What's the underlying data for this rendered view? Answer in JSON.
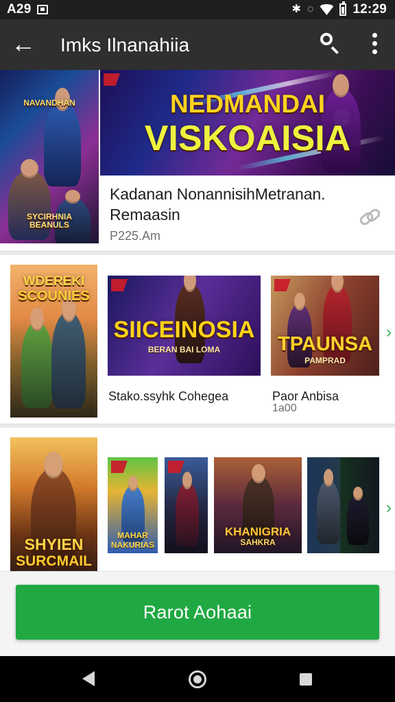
{
  "status_bar": {
    "time_left": "A29",
    "time_right": "12:29",
    "bluetooth_icon": "bluetooth-icon",
    "vibrate_icon": "vibrate-icon",
    "wifi_icon": "wifi-icon",
    "battery_icon": "battery-icon",
    "notification_icon": "notification-icon"
  },
  "app_bar": {
    "title": "Imks Ilnanahiia",
    "back_icon": "back-arrow-icon",
    "search_icon": "search-icon",
    "menu_icon": "more-vert-icon"
  },
  "featured": {
    "banner_title_top": "NEDMANDAI",
    "banner_title_bottom": "VISKOAISIA",
    "left_badge_top": "NAVANDHAN",
    "left_badge_bottom": "SYCIRHNIA\nBEANULS",
    "title_line_1": "Kadanan NonannisihMetranan.",
    "title_line_2": "Remaasin",
    "meta": "P225.Am",
    "link_icon": "link-icon"
  },
  "rows": [
    {
      "poster_title_top": "WDEREKI",
      "poster_title_bottom": "SCOUNIES",
      "items": [
        {
          "title_top": "SIICEINOSIA",
          "title_bottom": "BERAN BAI LOMA",
          "label": "Stako.ssyhk Cohegea"
        },
        {
          "title_top": "TPAUNSA",
          "title_bottom": "PAMPRAD",
          "label": "Paor Anbisa",
          "sublabel": "1a00"
        }
      ]
    },
    {
      "poster_title_top": "SHYIEN",
      "poster_title_bottom": "SURCMAIL",
      "items": [
        {
          "title_top": "MAHAR",
          "title_bottom": "NAKURIAS"
        },
        {
          "title_top": "",
          "title_bottom": ""
        },
        {
          "title_top": "KHANIGRIA",
          "title_bottom": "SAHKRA"
        },
        {
          "title_top": "",
          "title_bottom": ""
        }
      ]
    }
  ],
  "bottom": {
    "primary_button_label": "Rarot Aohaai"
  },
  "navigation": {
    "back_icon": "nav-back-icon",
    "home_icon": "nav-home-icon",
    "recent_icon": "nav-recent-icon"
  },
  "colors": {
    "status_bar": "#1f1f1f",
    "app_bar": "#2f2f2f",
    "accent_green": "#20a943",
    "chevron_green": "#32b24d",
    "background": "#f2f2f2",
    "nav_bar": "#000000"
  }
}
